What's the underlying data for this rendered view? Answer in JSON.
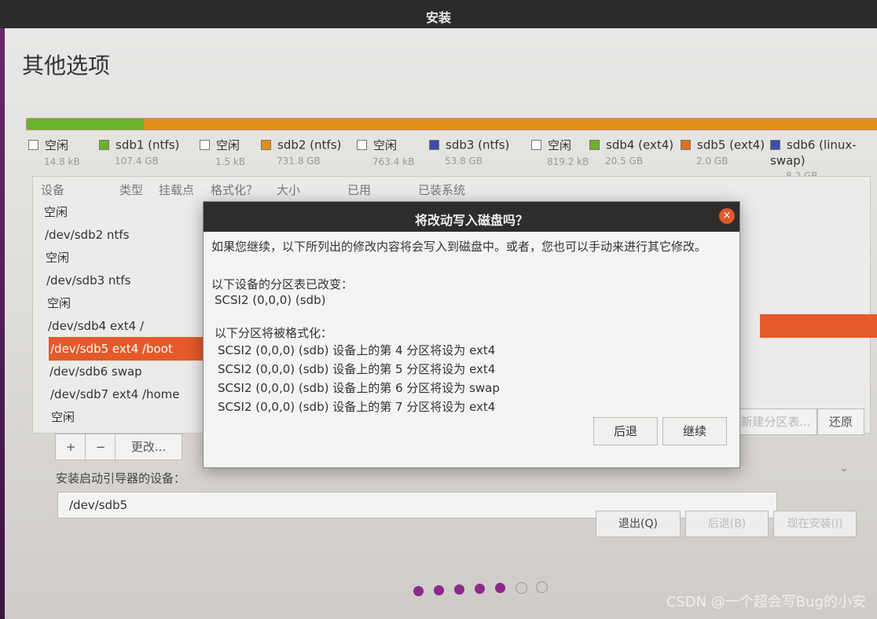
{
  "window": {
    "title": "安装"
  },
  "page": {
    "heading": "其他选项"
  },
  "partition_bar": {
    "segments": [
      {
        "share": 0.138,
        "color": "#6bb32c"
      },
      {
        "share": 0.862,
        "color": "#e0901a"
      }
    ]
  },
  "legend": [
    {
      "name": "空闲",
      "size": "14.8 kB",
      "color": "#ffffff"
    },
    {
      "name": "sdb1 (ntfs)",
      "size": "107.4 GB",
      "color": "#6bb32c"
    },
    {
      "name": "空闲",
      "size": "1.5 kB",
      "color": "#ffffff"
    },
    {
      "name": "sdb2 (ntfs)",
      "size": "731.8 GB",
      "color": "#e0901a"
    },
    {
      "name": "空闲",
      "size": "763.4 kB",
      "color": "#ffffff"
    },
    {
      "name": "sdb3 (ntfs)",
      "size": "53.8 GB",
      "color": "#3a4ea8"
    },
    {
      "name": "空闲",
      "size": "819.2 kB",
      "color": "#ffffff"
    },
    {
      "name": "sdb4 (ext4)",
      "size": "20.5 GB",
      "color": "#6bb32c"
    },
    {
      "name": "sdb5 (ext4)",
      "size": "2.0 GB",
      "color": "#e0701a"
    },
    {
      "name": "sdb6 (linux-swap)",
      "size": "8.2 GB",
      "color": "#3a4ea8"
    }
  ],
  "table": {
    "headers": [
      "设备",
      "类型",
      "挂载点",
      "格式化？",
      "大小",
      "已用",
      "已装系统"
    ],
    "rows": [
      "空闲",
      "/dev/sdb2  ntfs",
      "空闲",
      "/dev/sdb3  ntfs",
      "空闲",
      "/dev/sdb4  ext4   /",
      "/dev/sdb5  ext4   /boot",
      "/dev/sdb6  swap",
      "/dev/sdb7  ext4   /home",
      "空闲"
    ],
    "selected_row": 6
  },
  "table_toolbar": {
    "add": "+",
    "remove": "−",
    "change": "更改...",
    "new_table": "新建分区表...",
    "revert": "还原"
  },
  "bootloader": {
    "label": "安装启动引导器的设备：",
    "value": "/dev/sdb5"
  },
  "wizard_buttons": {
    "quit": "退出(Q)",
    "back": "后退(B)",
    "install": "现在安装(I)"
  },
  "progress_dots": {
    "total": 7,
    "done": 5
  },
  "dialog": {
    "title": "将改动写入磁盘吗？",
    "intro": "如果您继续，以下所列出的修改内容将会写入到磁盘中。或者，您也可以手动来进行其它修改。",
    "table_changed_label": "以下设备的分区表已改变：",
    "table_changed_device": "SCSI2 (0,0,0) (sdb)",
    "format_label": "以下分区将被格式化：",
    "format_items": [
      "SCSI2 (0,0,0) (sdb) 设备上的第 4 分区将设为 ext4",
      "SCSI2 (0,0,0) (sdb) 设备上的第 5 分区将设为 ext4",
      "SCSI2 (0,0,0) (sdb) 设备上的第 6 分区将设为 swap",
      "SCSI2 (0,0,0) (sdb) 设备上的第 7 分区将设为 ext4"
    ],
    "back_button": "后退",
    "continue_button": "继续",
    "close_glyph": "×"
  },
  "watermark": "CSDN @一个超会写Bug的小安"
}
